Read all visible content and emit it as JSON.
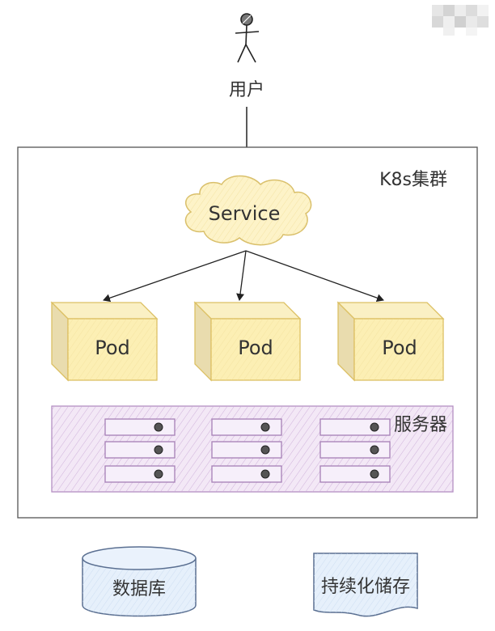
{
  "user": {
    "label": "用户",
    "icon": "stick-figure-user-icon"
  },
  "cluster": {
    "label": "K8s集群"
  },
  "service": {
    "label": "Service"
  },
  "pods": [
    {
      "label": "Pod"
    },
    {
      "label": "Pod"
    },
    {
      "label": "Pod"
    }
  ],
  "servers": {
    "label": "服务器"
  },
  "database": {
    "label": "数据库"
  },
  "storage": {
    "label": "持续化储存"
  },
  "colors": {
    "cloud_fill": "#fdf3c8",
    "cloud_stroke": "#d9bf6a",
    "pod_front": "#fcefb4",
    "pod_top": "#faf0c4",
    "pod_side": "#e9dcae",
    "pod_stroke": "#dcc063",
    "server_fill": "#f3e8f6",
    "server_stroke": "#b48fc2",
    "rack_stroke": "#a67fb6",
    "db_fill": "#e6f0fb",
    "db_stroke": "#5a6f91",
    "cluster_stroke": "#555555",
    "text": "#333333"
  }
}
